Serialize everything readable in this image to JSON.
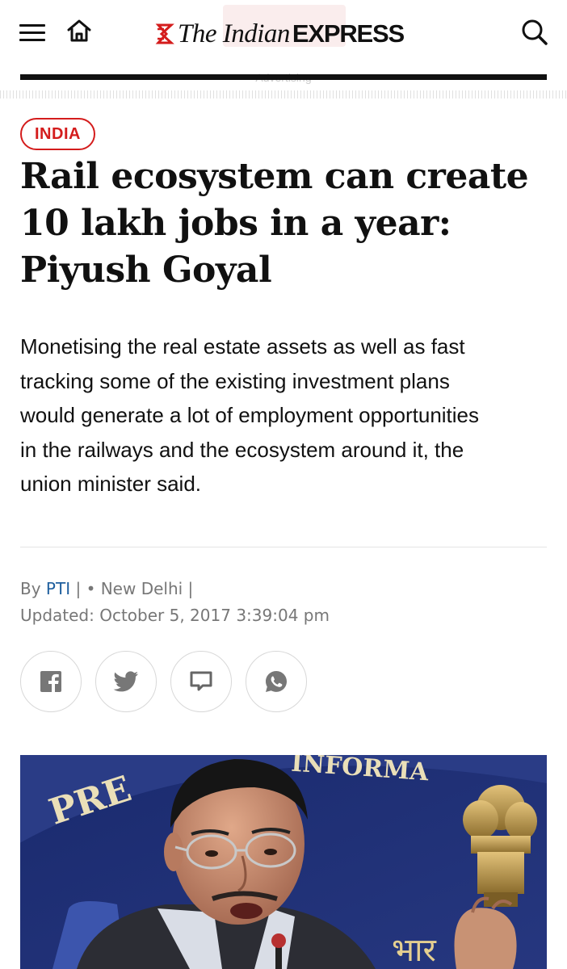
{
  "header": {
    "logo_the": "The Indian",
    "logo_express": "EXPRESS",
    "advertising_label": "Advertising",
    "icons": {
      "menu": "menu-icon",
      "home": "home-icon",
      "search": "search-icon"
    }
  },
  "article": {
    "category": "INDIA",
    "headline_lines": [
      "Rail ecosystem can create",
      "10 lakh jobs in a year:",
      "Piyush Goyal"
    ],
    "standfirst_lines": [
      "Monetising the real estate assets as well as fast",
      "tracking some of the existing investment plans",
      "would generate a lot of employment opportunities",
      "in the railways and the ecosystem around it, the",
      "union minister said."
    ],
    "byline": {
      "by": "By",
      "author": "PTI",
      "sep1": " | • ",
      "location": "New Delhi",
      "sep2": " |",
      "updated": "Updated: October 5, 2017 3:39:04 pm"
    },
    "share_icons": [
      "facebook-icon",
      "twitter-icon",
      "comment-icon",
      "whatsapp-icon"
    ],
    "photo": {
      "sign_text": "PRE",
      "sign_text_2": "INFORMA",
      "emblem_text": "भार"
    }
  },
  "colors": {
    "brand_red": "#d41c1c",
    "link_blue": "#1f5f9e",
    "meta_gray": "#777777",
    "backdrop_blue": "#1d2f76"
  }
}
